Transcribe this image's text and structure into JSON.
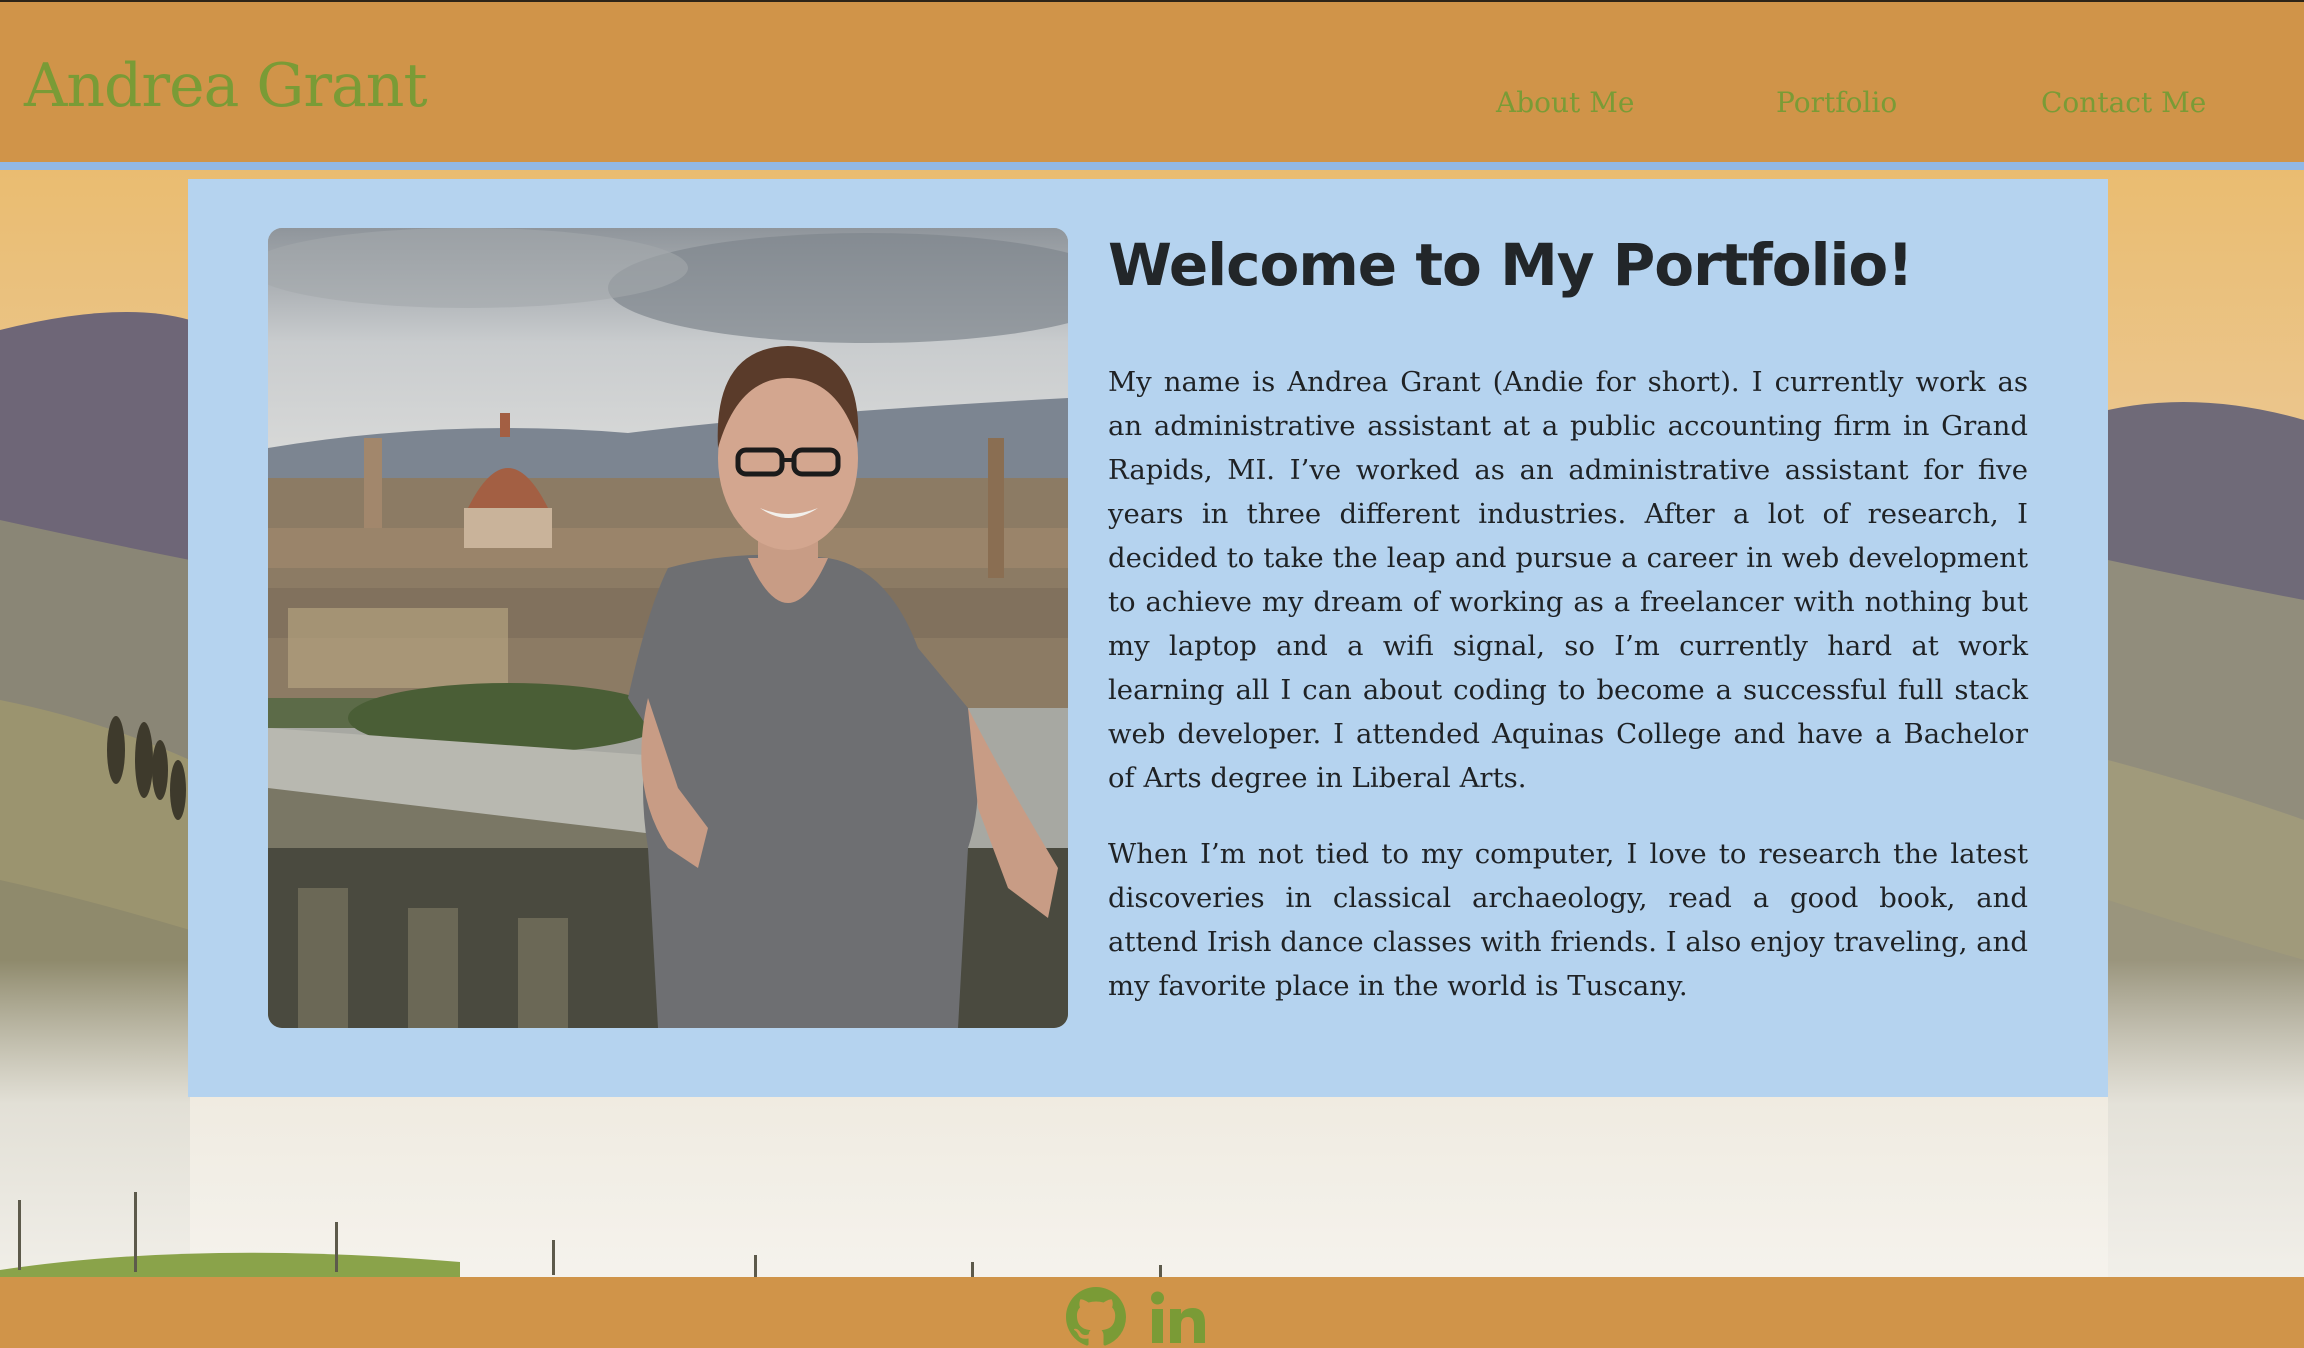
{
  "site": {
    "brand": "Andrea Grant"
  },
  "nav": {
    "items": [
      {
        "label": "About Me"
      },
      {
        "label": "Portfolio"
      },
      {
        "label": "Contact Me"
      }
    ]
  },
  "main": {
    "title": "Welcome to My Portfolio!",
    "paragraphs": [
      "My name is Andrea Grant (Andie for short). I currently work as an administrative assistant at a public accounting firm in Grand Rapids, MI. I’ve worked as an administrative assistant for five years in three different industries. After a lot of research, I decided to take the leap and pursue a career in web development to achieve my dream of working as a freelancer with nothing but my laptop and a wifi signal, so I’m currently hard at work learning all I can about coding to become a successful full stack web developer. I attended Aquinas College and have a Bachelor of Arts degree in Liberal Arts.",
      "When I’m not tied to my computer, I love to research the latest discoveries in classical archaeology, read a good book, and attend Irish dance classes with friends. I also enjoy traveling, and my favorite place in the world is Tuscany."
    ]
  },
  "footer": {
    "social": [
      {
        "icon": "github-icon"
      },
      {
        "icon": "linkedin-icon"
      }
    ]
  },
  "colors": {
    "header_bg": "#d09449",
    "accent_green": "#7a9b36",
    "card_bg": "#b5d3ef",
    "header_border": "#92b8e6"
  }
}
